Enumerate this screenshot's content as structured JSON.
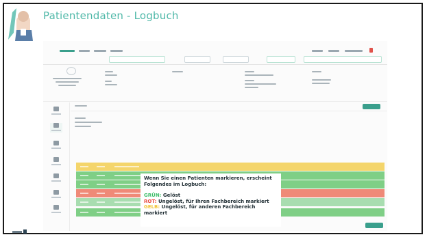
{
  "slide": {
    "title": "Patientendaten - Logbuch"
  },
  "note": {
    "intro": "Wenn Sie einen Patienten markieren, erscheint Folgendes im Logbuch:",
    "green_label": "GRÜN:",
    "green_text": " Gelöst",
    "red_label": "ROT:",
    "red_text": " Ungelöst, für Ihren Fachbereich markiert",
    "yellow_label": "GELB:",
    "yellow_text": " Ungelöst, für anderen Fachbereich markiert"
  },
  "colors": {
    "title": "#4fb8a8",
    "green": "#3fbf6a",
    "red": "#e84a3f",
    "yellow": "#f2c230",
    "row_yellow": "#f4d56b",
    "row_green": "#7fcf86",
    "row_red": "#ef8a78",
    "row_lightgreen": "#a8ddb0"
  },
  "log_rows": [
    {
      "status": "yellow"
    },
    {
      "status": "green"
    },
    {
      "status": "green"
    },
    {
      "status": "red"
    },
    {
      "status": "lightgreen"
    },
    {
      "status": "green"
    }
  ]
}
